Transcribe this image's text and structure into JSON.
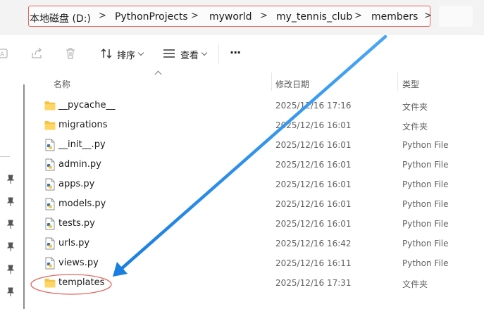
{
  "address_bar": {
    "crumbs": [
      "本地磁盘 (D:)",
      "PythonProjects",
      "myworld",
      "my_tennis_club",
      "members"
    ],
    "separator": ">"
  },
  "toolbar": {
    "sort_label": "排序",
    "view_label": "查看",
    "more_label": "···"
  },
  "columns": {
    "name": "名称",
    "date": "修改日期",
    "type": "类型"
  },
  "files": [
    {
      "name": "__pycache__",
      "date": "2025/12/16 17:16",
      "type": "文件夹",
      "icon": "folder-icon"
    },
    {
      "name": "migrations",
      "date": "2025/12/16 16:01",
      "type": "文件夹",
      "icon": "folder-icon"
    },
    {
      "name": "__init__.py",
      "date": "2025/12/16 16:01",
      "type": "Python File",
      "icon": "python-file-icon"
    },
    {
      "name": "admin.py",
      "date": "2025/12/16 16:01",
      "type": "Python File",
      "icon": "python-file-icon"
    },
    {
      "name": "apps.py",
      "date": "2025/12/16 16:01",
      "type": "Python File",
      "icon": "python-file-icon"
    },
    {
      "name": "models.py",
      "date": "2025/12/16 16:01",
      "type": "Python File",
      "icon": "python-file-icon"
    },
    {
      "name": "tests.py",
      "date": "2025/12/16 16:01",
      "type": "Python File",
      "icon": "python-file-icon"
    },
    {
      "name": "urls.py",
      "date": "2025/12/16 16:42",
      "type": "Python File",
      "icon": "python-file-icon"
    },
    {
      "name": "views.py",
      "date": "2025/12/16 16:11",
      "type": "Python File",
      "icon": "python-file-icon"
    },
    {
      "name": "templates",
      "date": "2025/12/16 17:31",
      "type": "文件夹",
      "icon": "folder-icon"
    }
  ],
  "colors": {
    "annotation_red": "#e0665f",
    "annotation_arrow": "#1e8ef0",
    "folder": "#f5c244"
  }
}
